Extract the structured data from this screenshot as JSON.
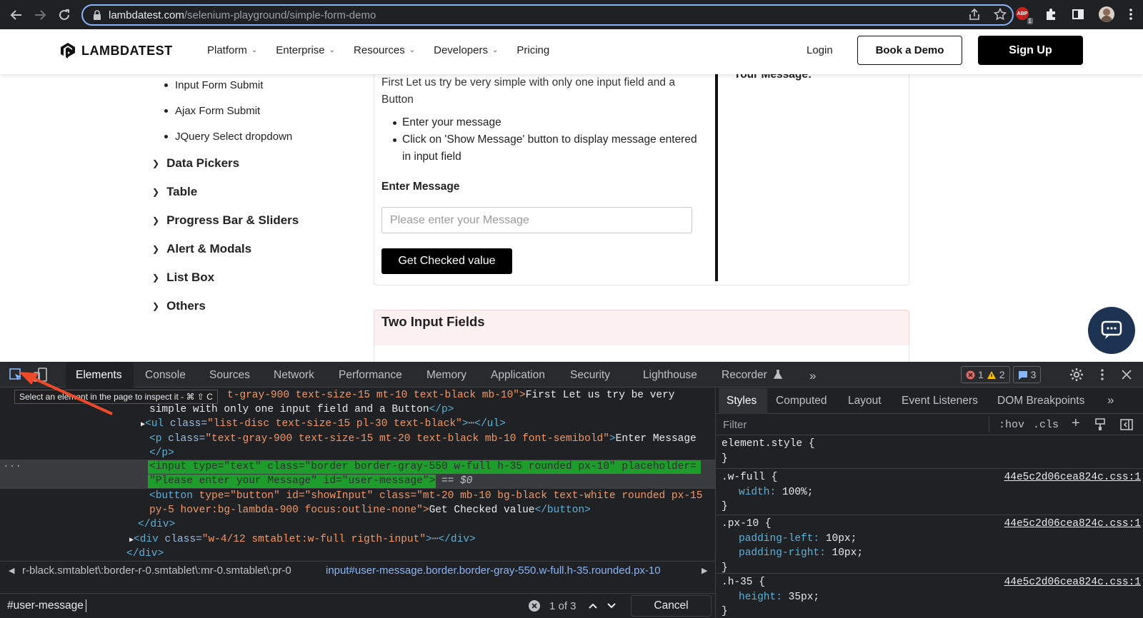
{
  "browser": {
    "url_host": "lambdatest.com",
    "url_path": "/selenium-playground/simple-form-demo",
    "ext_badge": "1"
  },
  "header": {
    "logo_text": "LAMBDATEST",
    "nav": [
      "Platform",
      "Enterprise",
      "Resources",
      "Developers",
      "Pricing"
    ],
    "login": "Login",
    "book_demo": "Book a Demo",
    "sign_up": "Sign Up"
  },
  "sidebar": {
    "sub_items": [
      "Input Form Submit",
      "Ajax Form Submit",
      "JQuery Select dropdown"
    ],
    "categories": [
      "Data Pickers",
      "Table",
      "Progress Bar & Sliders",
      "Alert & Modals",
      "List Box",
      "Others"
    ]
  },
  "form": {
    "intro": "First Let us try be very simple with only one input field and a Button",
    "bullets": [
      "Enter your message",
      "Click on 'Show Message' button to display message entered in input field"
    ],
    "enter_label": "Enter Message",
    "placeholder": "Please enter your Message",
    "button": "Get Checked value",
    "your_message": "Your Message:",
    "section2_title": "Two Input Fields"
  },
  "devtools": {
    "tabs": [
      "Elements",
      "Console",
      "Sources",
      "Network",
      "Performance",
      "Memory",
      "Application",
      "Security",
      "Lighthouse",
      "Recorder"
    ],
    "errors": "1",
    "warnings": "2",
    "messages": "3",
    "tooltip": "Select an element in the page to inspect it - ⌘ ⇧ C",
    "dom": {
      "line0_tail": "t-gray-900 text-size-15 mt-10 text-black mb-10\">",
      "line0_text": "First Let us try be very",
      "line1_text": "simple with only one input field and a Button",
      "ul_attr_val": "\"list-disc text-size-15 pl-30 text-black\"",
      "p2_attr_val": "\"text-gray-900 text-size-15 mt-20 text-black mb-10 font-semibold\"",
      "p2_text": "Enter Message",
      "sel_line1": "<input type=\"text\" class=\"border border-gray-550 w-full h-35 rounded px-10\" placeholder=",
      "sel_line2": "\"Please enter your Message\" id=\"user-message\">",
      "dollar": "== $0",
      "button_attrs1": "type=\"button\" id=\"showInput\" class=\"mt-20 mb-10 bg-black text-white rounded px-15",
      "button_attrs2": "py-5 hover:bg-lambda-900 focus:outline-none\">",
      "button_text": "Get Checked value",
      "div_attr_val": "\"w-4/12 smtablet:w-full rigth-input\""
    },
    "breadcrumb1": "r-black.smtablet\\:border-r-0.smtablet\\:mr-0.smtablet\\:pr-0",
    "breadcrumb2_tag": "input",
    "breadcrumb2_rest": "#user-message.border.border-gray-550.w-full.h-35.rounded.px-10",
    "find_value": "#user-message",
    "find_count": "1 of 3",
    "find_cancel": "Cancel",
    "styles_tabs": [
      "Styles",
      "Computed",
      "Layout",
      "Event Listeners",
      "DOM Breakpoints"
    ],
    "filter_placeholder": "Filter",
    "hov": ":hov",
    "cls": ".cls",
    "rules": [
      {
        "selector": "element.style {",
        "source": "",
        "props": [],
        "close": "}"
      },
      {
        "selector": ".w-full {",
        "source": "44e5c2d06cea824c.css:1",
        "props": [
          [
            "width",
            "100%;"
          ]
        ],
        "close": "}"
      },
      {
        "selector": ".px-10 {",
        "source": "44e5c2d06cea824c.css:1",
        "props": [
          [
            "padding-left",
            "10px;"
          ],
          [
            "padding-right",
            "10px;"
          ]
        ],
        "close": "}"
      },
      {
        "selector": ".h-35 {",
        "source": "44e5c2d06cea824c.css:1",
        "props": [
          [
            "height",
            "35px;"
          ]
        ],
        "close": "}"
      }
    ]
  }
}
